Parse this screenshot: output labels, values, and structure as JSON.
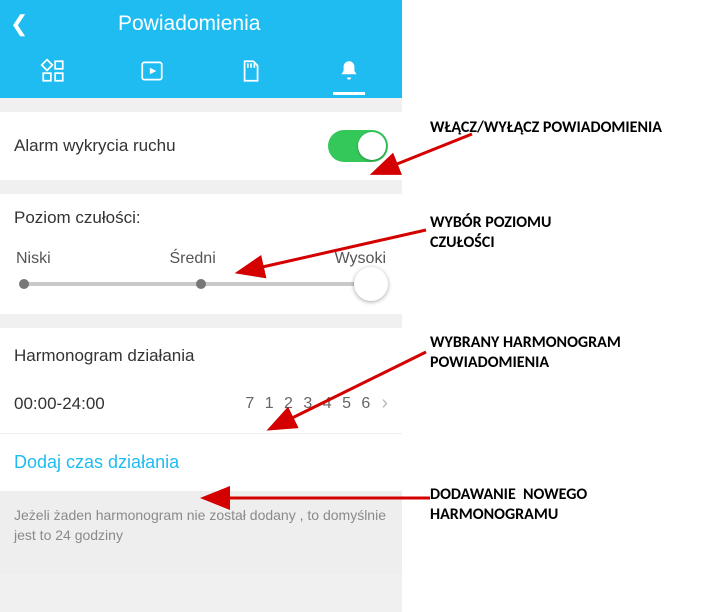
{
  "header": {
    "title": "Powiadomienia"
  },
  "motion": {
    "label": "Alarm wykrycia ruchu",
    "enabled": true
  },
  "sensitivity": {
    "title": "Poziom czułości:",
    "low": "Niski",
    "mid": "Średni",
    "high": "Wysoki"
  },
  "schedule": {
    "title": "Harmonogram działania",
    "range": "00:00-24:00",
    "days": "7 1 2 3 4 5 6"
  },
  "add_schedule_label": "Dodaj czas działania",
  "footer_note": "Jeżeli żaden harmonogram nie został dodany , to domyślnie jest to 24 godziny",
  "annotations": {
    "a1": "WŁĄCZ/WYŁĄCZ POWIADOMIENIA",
    "a2": "WYBÓR POZIOMU\nCZUŁOŚCI",
    "a3": "WYBRANY HARMONOGRAM\nPOWIADOMIENIA",
    "a4": "DODAWANIE  NOWEGO\nHARMONOGRAMU"
  }
}
